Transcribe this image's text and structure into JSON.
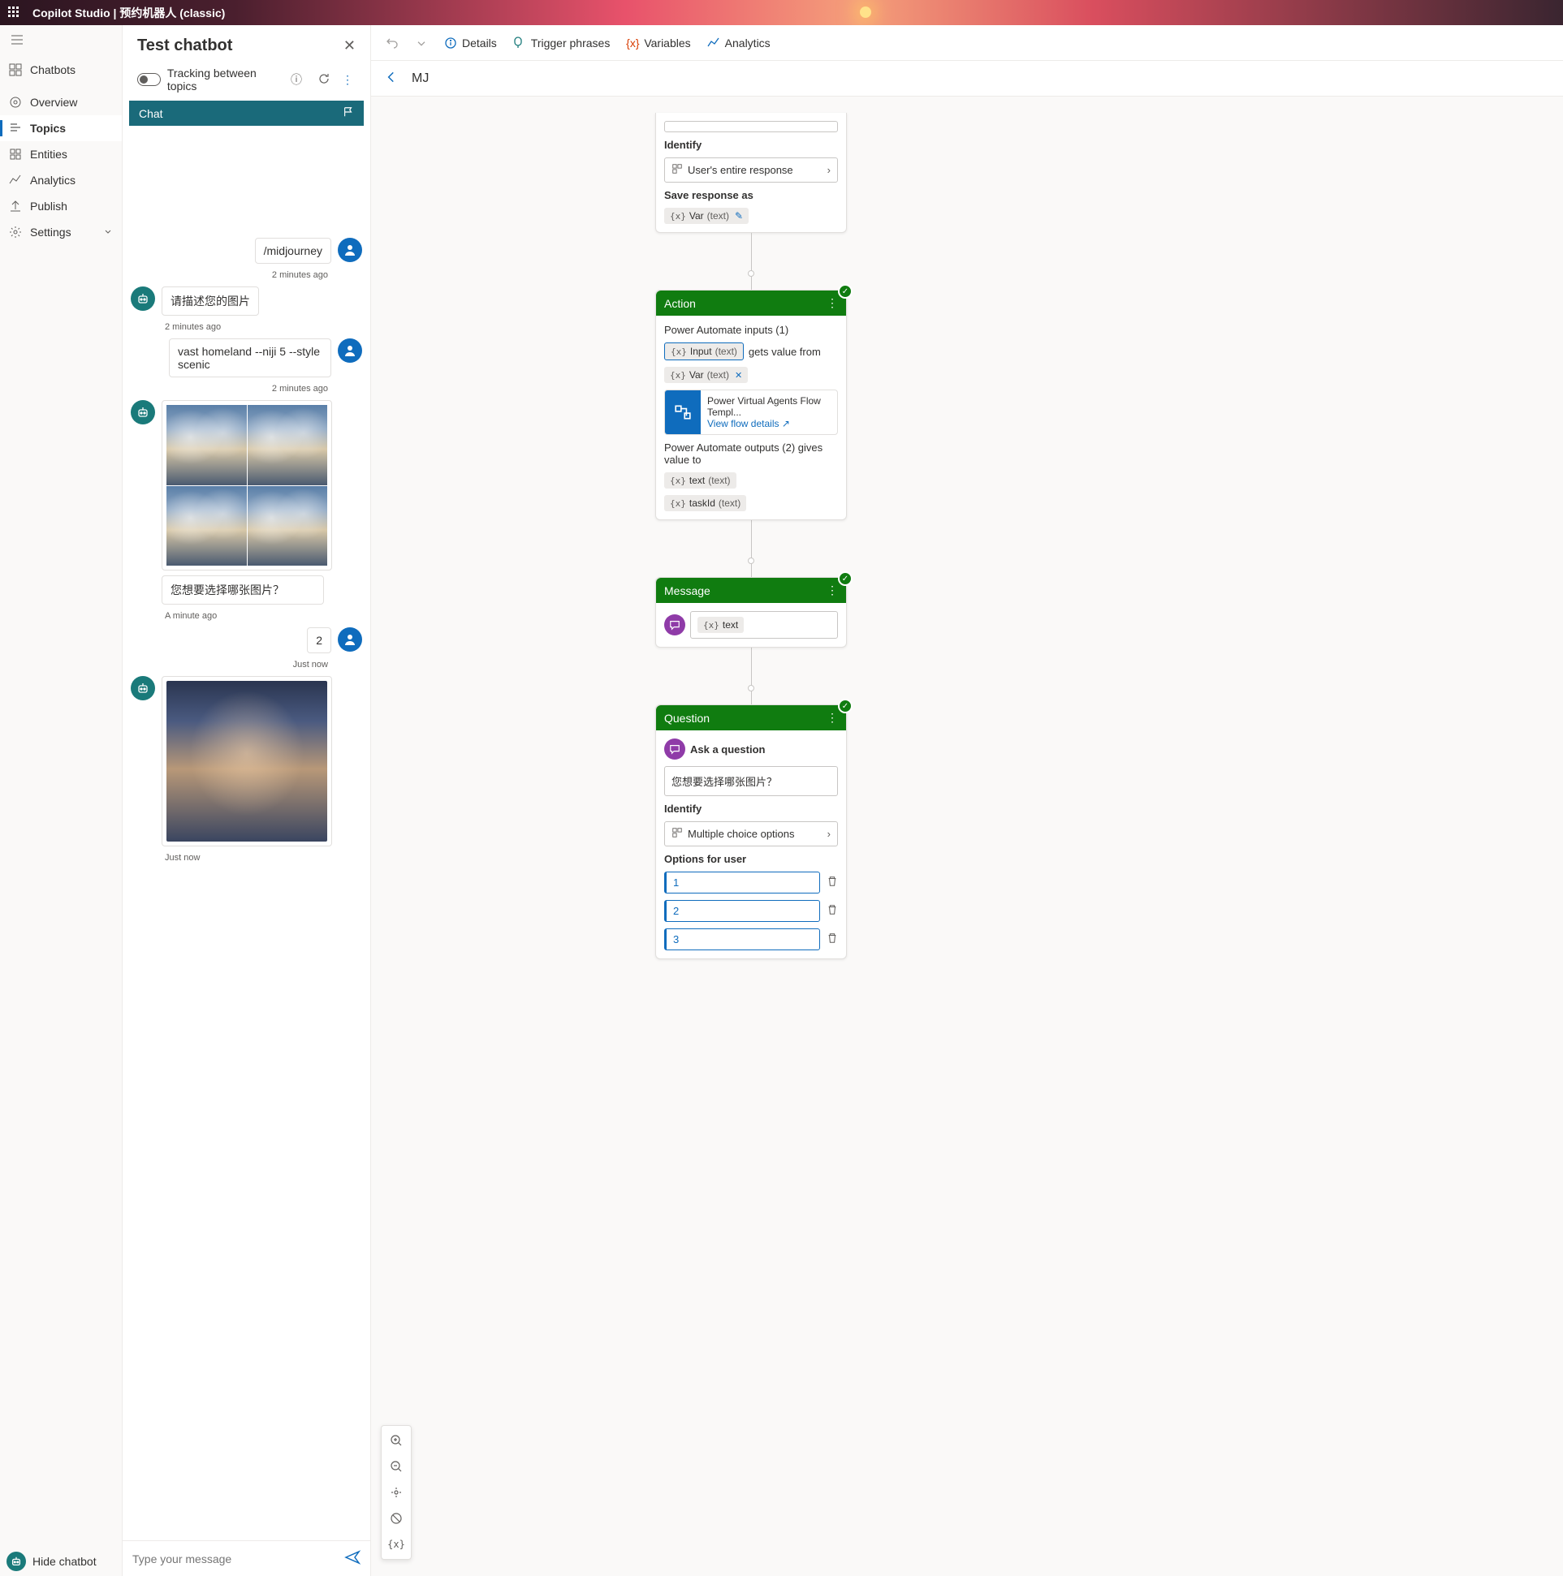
{
  "topbar": {
    "app": "Copilot Studio",
    "sep": " | ",
    "bot": "预约机器人 (classic)"
  },
  "sidebar": {
    "chatbots": "Chatbots",
    "overview": "Overview",
    "topics": "Topics",
    "entities": "Entities",
    "analytics": "Analytics",
    "publish": "Publish",
    "settings": "Settings"
  },
  "test_panel": {
    "title": "Test chatbot",
    "tracking": "Tracking between topics",
    "chat_tab": "Chat",
    "input_placeholder": "Type your message",
    "messages": {
      "m1": "/midjourney",
      "t1": "2 minutes ago",
      "m2": "请描述您的图片",
      "t2": "2 minutes ago",
      "m3": "vast homeland --niji 5 --style scenic",
      "t3": "2 minutes ago",
      "m4": "您想要选择哪张图片？",
      "t4": "A minute ago",
      "m5": "2",
      "t5": "Just now",
      "t6": "Just now"
    }
  },
  "hide_chatbot": "Hide chatbot",
  "canvas": {
    "toolbar": {
      "details": "Details",
      "trigger": "Trigger phrases",
      "variables": "Variables",
      "analytics": "Analytics"
    },
    "topic_name": "MJ",
    "node_q1": {
      "identify_label": "Identify",
      "identify_value": "User's entire response",
      "save_label": "Save response as",
      "var_name": "Var",
      "var_type": "(text)"
    },
    "node_action": {
      "title": "Action",
      "inputs_label": "Power Automate inputs (1)",
      "input_name": "Input",
      "input_type": "(text)",
      "gets": "gets value from",
      "var_name": "Var",
      "var_type": "(text)",
      "flow_title": "Power Virtual Agents Flow Templ...",
      "flow_link": "View flow details",
      "outputs_label": "Power Automate outputs (2) gives value to",
      "out1_name": "text",
      "out1_type": "(text)",
      "out2_name": "taskId",
      "out2_type": "(text)"
    },
    "node_message": {
      "title": "Message",
      "var_name": "text"
    },
    "node_question": {
      "title": "Question",
      "ask": "Ask a question",
      "text": "您想要选择哪张图片？",
      "identify_label": "Identify",
      "identify_value": "Multiple choice options",
      "options_label": "Options for user",
      "opt1": "1",
      "opt2": "2",
      "opt3": "3"
    }
  }
}
